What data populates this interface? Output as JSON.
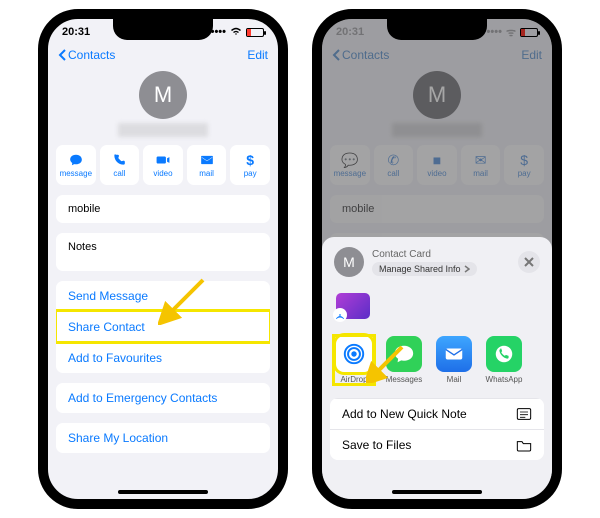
{
  "status": {
    "time": "20:31"
  },
  "nav": {
    "back": "Contacts",
    "edit": "Edit"
  },
  "avatar_initial": "M",
  "actions": [
    {
      "name": "message",
      "label": "message",
      "icon": "message-icon"
    },
    {
      "name": "call",
      "label": "call",
      "icon": "phone-icon"
    },
    {
      "name": "video",
      "label": "video",
      "icon": "video-icon"
    },
    {
      "name": "mail",
      "label": "mail",
      "icon": "mail-icon"
    },
    {
      "name": "pay",
      "label": "pay",
      "icon": "pay-icon"
    }
  ],
  "fields": {
    "mobile": "mobile",
    "notes": "Notes"
  },
  "links": {
    "send_message": "Send Message",
    "share_contact": "Share Contact",
    "add_favourites": "Add to Favourites",
    "add_emergency": "Add to Emergency Contacts",
    "share_location": "Share My Location"
  },
  "sheet": {
    "title": "Contact Card",
    "manage": "Manage Shared Info",
    "apps": [
      {
        "name": "airdrop",
        "label": "AirDrop",
        "highlight": true
      },
      {
        "name": "messages",
        "label": "Messages"
      },
      {
        "name": "mail",
        "label": "Mail"
      },
      {
        "name": "whatsapp",
        "label": "WhatsApp"
      }
    ],
    "list": {
      "quick_note": "Add to New Quick Note",
      "save_files": "Save to Files"
    }
  }
}
